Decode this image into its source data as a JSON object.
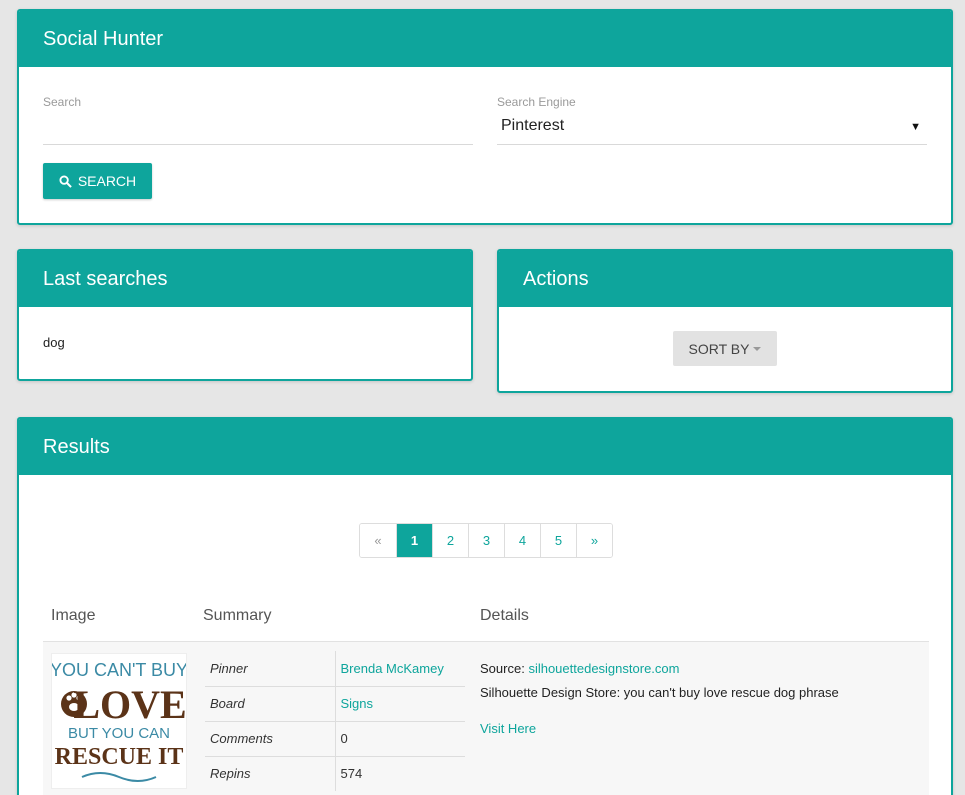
{
  "app": {
    "title": "Social Hunter"
  },
  "colors": {
    "accent": "#0ea59c",
    "background": "#e6e6e6"
  },
  "search": {
    "label": "Search",
    "value": "",
    "engine_label": "Search Engine",
    "engine_value": "Pinterest",
    "button_label": "SEARCH"
  },
  "last_searches": {
    "title": "Last searches",
    "items": [
      "dog"
    ]
  },
  "actions": {
    "title": "Actions",
    "sort_label": "SORT BY"
  },
  "results": {
    "title": "Results",
    "pagination": {
      "prev": "«",
      "pages": [
        "1",
        "2",
        "3",
        "4",
        "5"
      ],
      "next": "»",
      "current": "1"
    },
    "columns": [
      "Image",
      "Summary",
      "Details"
    ],
    "rows": [
      {
        "image_text": {
          "line1": "YOU CAN'T BUY",
          "line2": "LOVE",
          "line3": "BUT YOU CAN",
          "line4": "RESCUE IT"
        },
        "summary": [
          {
            "key": "Pinner",
            "value": "Brenda McKamey",
            "link": true
          },
          {
            "key": "Board",
            "value": "Signs",
            "link": true
          },
          {
            "key": "Comments",
            "value": "0",
            "link": false
          },
          {
            "key": "Repins",
            "value": "574",
            "link": false
          }
        ],
        "details": {
          "source_label": "Source:",
          "source_link": "silhouettedesignstore.com",
          "description": "Silhouette Design Store: you can't buy love rescue dog phrase",
          "visit_label": "Visit Here"
        }
      }
    ]
  }
}
